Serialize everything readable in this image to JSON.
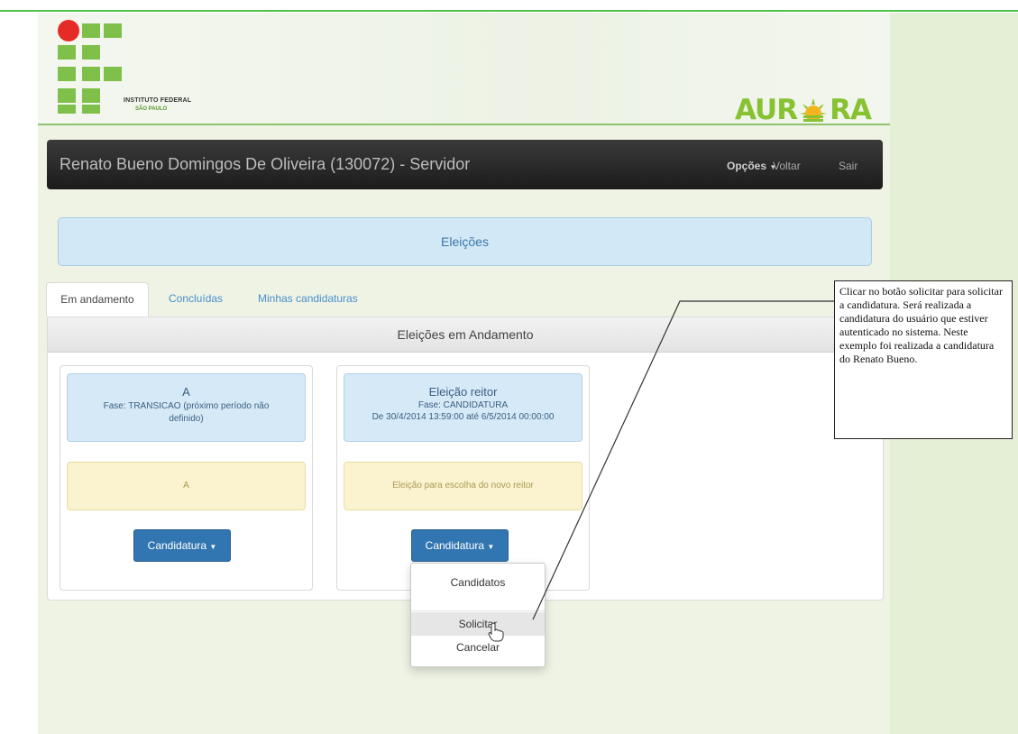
{
  "header": {
    "institution_name": "INSTITUTO FEDERAL",
    "institution_sub": "SÃO PAULO",
    "app_logo_text": [
      "AUR",
      "RA"
    ]
  },
  "navbar": {
    "user": "Renato Bueno Domingos De Oliveira (130072) - Servidor",
    "options_label": "Opções",
    "back_label": "Voltar",
    "exit_label": "Sair"
  },
  "page": {
    "title": "Eleições"
  },
  "tabs": [
    {
      "label": "Em andamento",
      "active": true
    },
    {
      "label": "Concluídas",
      "active": false
    },
    {
      "label": "Minhas candidaturas",
      "active": false
    }
  ],
  "panel": {
    "heading": "Eleições em Andamento"
  },
  "elections": [
    {
      "title": "A",
      "phase": "Fase: TRANSICAO (próximo período não definido)",
      "period": "",
      "description": "A",
      "button": "Candidatura"
    },
    {
      "title": "Eleição reitor",
      "phase": "Fase: CANDIDATURA",
      "period": "De 30/4/2014 13:59:00 até 6/5/2014 00:00:00",
      "description": "Eleição para escolha do novo reitor",
      "button": "Candidatura"
    }
  ],
  "dropdown": {
    "items": [
      "Candidatos",
      "Solicitar",
      "Cancelar"
    ],
    "hovered": "Solicitar"
  },
  "callout": {
    "text": "Clicar no botão solicitar para solicitar a candidatura. Será realizada a candidatura do usuário que estiver autenticado no sistema. Neste exemplo foi realizada a candidatura do Renato Bueno."
  },
  "colors": {
    "brand_green": "#7fc04b",
    "logo_red": "#e52b25",
    "navbar": "#2a2a2a",
    "primary_button": "#3276b1",
    "info_bg": "#d5e9f7",
    "warning_bg": "#fbf3cf"
  },
  "icons": {
    "caret": "caret-down-icon",
    "cursor": "hand-pointer-icon",
    "sun": "aurora-sun-icon"
  }
}
